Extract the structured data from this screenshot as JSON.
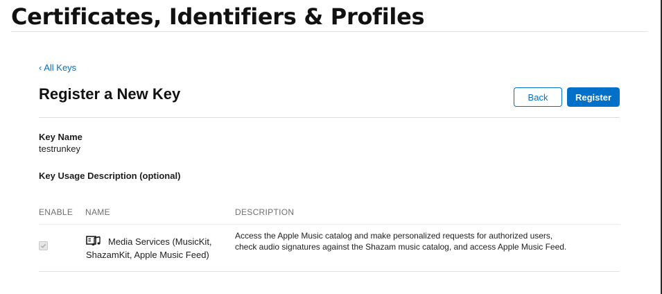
{
  "header": {
    "title": "Certificates, Identifiers & Profiles"
  },
  "nav": {
    "back_link": "‹ All Keys"
  },
  "section": {
    "title": "Register a New Key"
  },
  "actions": {
    "back_label": "Back",
    "register_label": "Register"
  },
  "fields": {
    "key_name_label": "Key Name",
    "key_name_value": "testrunkey",
    "usage_label": "Key Usage Description (optional)"
  },
  "table": {
    "columns": {
      "enable": "ENABLE",
      "name": "NAME",
      "description": "DESCRIPTION"
    },
    "rows": [
      {
        "enabled": true,
        "icon": "media-services-icon",
        "name": "Media Services (MusicKit, ShazamKit, Apple Music Feed)",
        "description": "Access the Apple Music catalog and make personalized requests for authorized users, check audio signatures against the Shazam music catalog, and access Apple Music Feed."
      }
    ]
  },
  "colors": {
    "accent": "#0070c9",
    "text": "#1d1d1f",
    "muted": "#6e6e73"
  }
}
